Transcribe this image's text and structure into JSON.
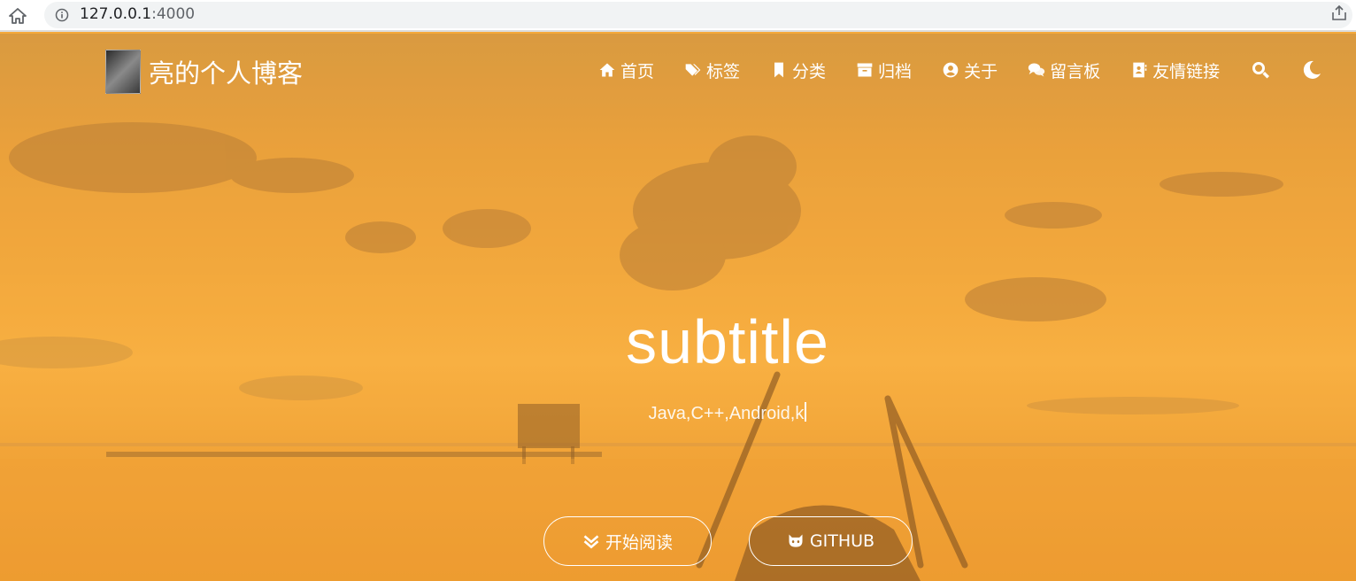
{
  "browser": {
    "url_host": "127.0.0.1",
    "url_port": ":4000"
  },
  "brand": {
    "title": "亮的个人博客",
    "logo_icon": "thinker-statue-avatar"
  },
  "nav": {
    "items": [
      {
        "label": "首页",
        "icon": "home-icon"
      },
      {
        "label": "标签",
        "icon": "tags-icon"
      },
      {
        "label": "分类",
        "icon": "bookmark-icon"
      },
      {
        "label": "归档",
        "icon": "archive-icon"
      },
      {
        "label": "关于",
        "icon": "user-circle-icon"
      },
      {
        "label": "留言板",
        "icon": "comments-icon"
      },
      {
        "label": "友情链接",
        "icon": "address-book-icon"
      }
    ],
    "search_icon": "search-icon",
    "theme_icon": "moon-icon"
  },
  "hero": {
    "title": "subtitle",
    "typed_text": "Java,C++,Android,k"
  },
  "buttons": {
    "start_label": "开始阅读",
    "github_label": "GITHUB"
  },
  "colors": {
    "hero_base": "#f5a93a",
    "text": "#ffffff"
  }
}
